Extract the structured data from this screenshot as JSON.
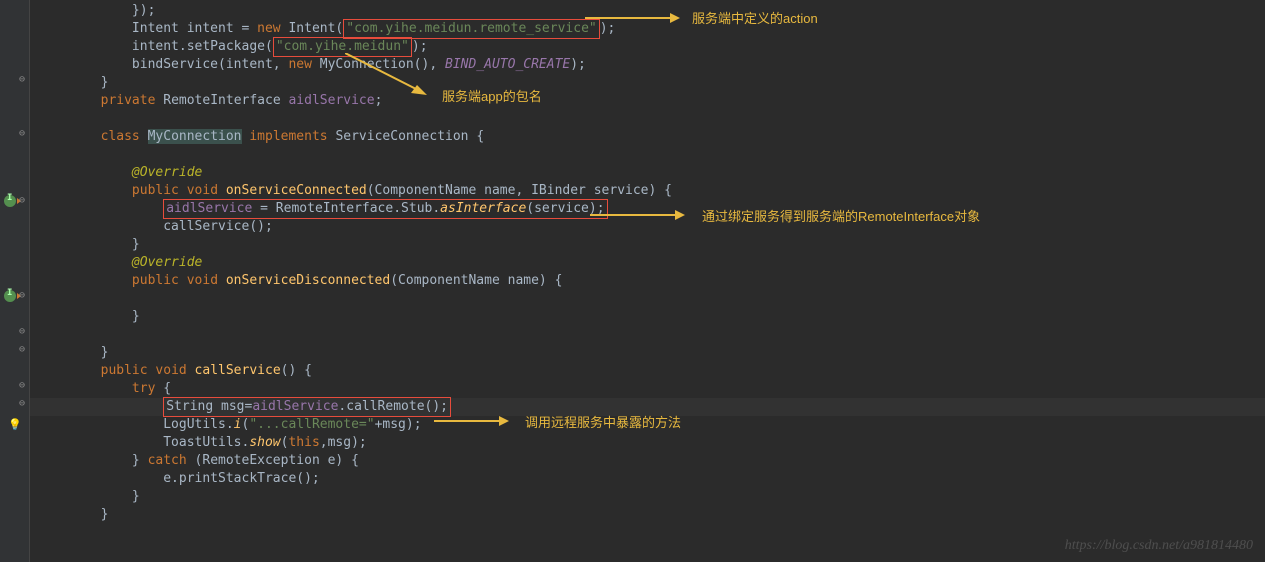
{
  "code": {
    "l1": "            });",
    "l2_a": "            Intent intent = ",
    "l2_b": "new",
    "l2_c": " Intent(",
    "l2_d": "\"com.yihe.meidun.remote_service\"",
    "l2_e": ");",
    "l3_a": "            intent.setPackage(",
    "l3_b": "\"com.yihe.meidun\"",
    "l3_c": ");",
    "l4_a": "            bindService(intent, ",
    "l4_b": "new",
    "l4_c": " MyConnection(), ",
    "l4_d": "BIND_AUTO_CREATE",
    "l4_e": ");",
    "l5": "        }",
    "l6_a": "        ",
    "l6_b": "private",
    "l6_c": " RemoteInterface ",
    "l6_d": "aidlService",
    "l6_e": ";",
    "l8_a": "        ",
    "l8_b": "class",
    "l8_c": " ",
    "l8_d": "MyConnection",
    "l8_e": " ",
    "l8_f": "implements",
    "l8_g": " ServiceConnection {",
    "l10": "            @Override",
    "l11_a": "            ",
    "l11_b": "public void",
    "l11_c": " ",
    "l11_d": "onServiceConnected",
    "l11_e": "(ComponentName name, IBinder service) {",
    "l12_a": "                ",
    "l12_b": "aidlService",
    "l12_c": " = RemoteInterface.Stub.",
    "l12_d": "asInterface",
    "l12_e": "(service);",
    "l13": "                callService();",
    "l14": "            }",
    "l15": "            @Override",
    "l16_a": "            ",
    "l16_b": "public void",
    "l16_c": " ",
    "l16_d": "onServiceDisconnected",
    "l16_e": "(ComponentName name) {",
    "l18": "            }",
    "l20": "        }",
    "l21_a": "        ",
    "l21_b": "public void",
    "l21_c": " ",
    "l21_d": "callService",
    "l21_e": "() {",
    "l22_a": "            ",
    "l22_b": "try",
    "l22_c": " {",
    "l23_a": "                ",
    "l23_b": "String msg=",
    "l23_c": "aidlService",
    "l23_d": ".callRemote();",
    "l24_a": "                LogUtils.",
    "l24_b": "i",
    "l24_c": "(",
    "l24_d": "\"...callRemote=\"",
    "l24_e": "+msg);",
    "l25_a": "                ToastUtils.",
    "l25_b": "show",
    "l25_c": "(",
    "l25_d": "this",
    "l25_e": ",msg);",
    "l26_a": "            } ",
    "l26_b": "catch",
    "l26_c": " (RemoteException e) {",
    "l27": "                e.printStackTrace();",
    "l28": "            }",
    "l29": "        }"
  },
  "annotations": {
    "a1": "服务端中定义的action",
    "a2": "服务端app的包名",
    "a3": "通过绑定服务得到服务端的RemoteInterface对象",
    "a4": "调用远程服务中暴露的方法"
  },
  "watermark": "https://blog.csdn.net/a981814480"
}
